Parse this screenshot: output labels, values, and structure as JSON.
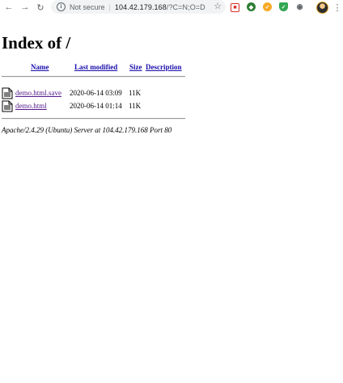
{
  "browser": {
    "security_label": "Not secure",
    "url_host": "104.42.179.168",
    "url_path": "/?C=N;O=D",
    "icons": [
      "back-icon",
      "forward-icon",
      "reload-icon",
      "info-icon",
      "star-icon",
      "extension-icons",
      "profile-avatar",
      "menu-icon"
    ]
  },
  "page": {
    "title": "Index of /",
    "columns": {
      "name": "Name",
      "last_modified": "Last modified",
      "size": "Size",
      "description": "Description"
    },
    "files": [
      {
        "name": "demo.html.save",
        "modified": "2020-06-14 03:09",
        "size": "11K",
        "description": ""
      },
      {
        "name": "demo.html",
        "modified": "2020-06-14 01:14",
        "size": "11K",
        "description": ""
      }
    ],
    "footer": "Apache/2.4.29 (Ubuntu) Server at 104.42.179.168 Port 80"
  },
  "colors": {
    "link": "#1a0dab",
    "visited_link": "#551a8b",
    "toolbar_bg": "#ffffff",
    "omnibox_bg": "#f1f3f4"
  }
}
